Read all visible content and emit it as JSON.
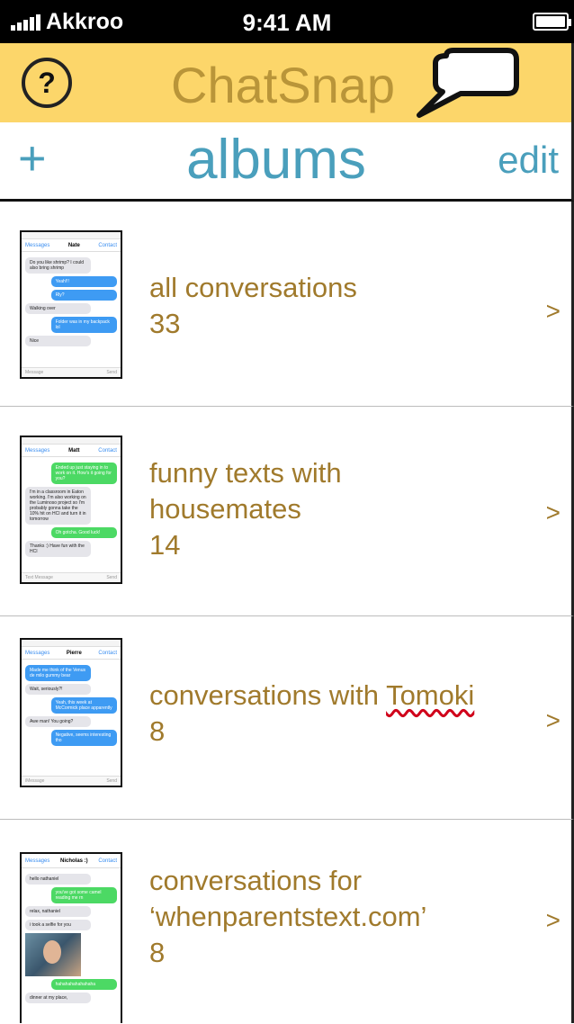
{
  "status": {
    "carrier": "Akkroo",
    "time": "9:41 AM"
  },
  "appbar": {
    "title": "ChatSnap",
    "help_label": "?"
  },
  "navbar": {
    "add_label": "+",
    "title": "albums",
    "edit_label": "edit"
  },
  "albums": [
    {
      "name": "all conversations",
      "count": "33",
      "chevron": ">",
      "preview": {
        "contact": "Nate",
        "back": "Messages",
        "right": "Contact",
        "messages": [
          {
            "dir": "in",
            "text": "Do you like shrimp? I could also bring shrimp"
          },
          {
            "dir": "out",
            "text": "Yeah!!!"
          },
          {
            "dir": "out",
            "text": "Rly?"
          },
          {
            "dir": "in",
            "text": "Walking over"
          },
          {
            "dir": "out",
            "text": "Folder was in my backpack lol"
          },
          {
            "dir": "in",
            "text": "Nice"
          }
        ],
        "input": "Message",
        "send": "Send"
      }
    },
    {
      "name": "funny texts with housemates",
      "count": "14",
      "chevron": ">",
      "preview": {
        "contact": "Matt",
        "back": "Messages",
        "right": "Contact",
        "messages": [
          {
            "dir": "green",
            "text": "Ended up just staying in to work on it. How's it going for you?"
          },
          {
            "dir": "in",
            "text": "I'm in a classroom in Eaton working. I'm also working on the Luminoso project so I'm probably gonna take the 10% hit on HCI and turn it in tomorrow"
          },
          {
            "dir": "green",
            "text": "Oh gotcha. Good luck!"
          },
          {
            "dir": "in",
            "text": "Thanks :) Have fun with the HCI"
          }
        ],
        "input": "Text Message",
        "send": "Send"
      }
    },
    {
      "name_prefix": "conversations with ",
      "name_flagged": "Tomoki",
      "count": "8",
      "chevron": ">",
      "preview": {
        "contact": "Pierre",
        "back": "Messages",
        "right": "Contact",
        "messages": [
          {
            "dir": "out",
            "text": "Made me think of the Venus de milo gummy bear"
          },
          {
            "dir": "in",
            "text": "Wait, seriously?!"
          },
          {
            "dir": "out",
            "text": "Yeah, this week at McCormick place apparently"
          },
          {
            "dir": "in",
            "text": "Awe man! You going?"
          },
          {
            "dir": "out",
            "text": "Negative, seems interesting tho"
          }
        ],
        "input": "iMessage",
        "send": "Send"
      }
    },
    {
      "name_line1": "conversations for",
      "name_line2": "‘whenparentstext.com’",
      "count": "8",
      "chevron": ">",
      "preview": {
        "contact": "Nicholas :)",
        "back": "Messages",
        "right": "Contact",
        "messages": [
          {
            "dir": "in",
            "text": "hello nathaniel"
          },
          {
            "dir": "green",
            "text": "you've got some camel reading me rn"
          },
          {
            "dir": "in",
            "text": "relax, nathaniel"
          },
          {
            "dir": "in",
            "text": "i took a selfie for you"
          },
          {
            "dir": "photo",
            "text": ""
          },
          {
            "dir": "green",
            "text": "hahahahahahahaha"
          },
          {
            "dir": "in",
            "text": "dinner at my place,"
          }
        ]
      }
    }
  ]
}
